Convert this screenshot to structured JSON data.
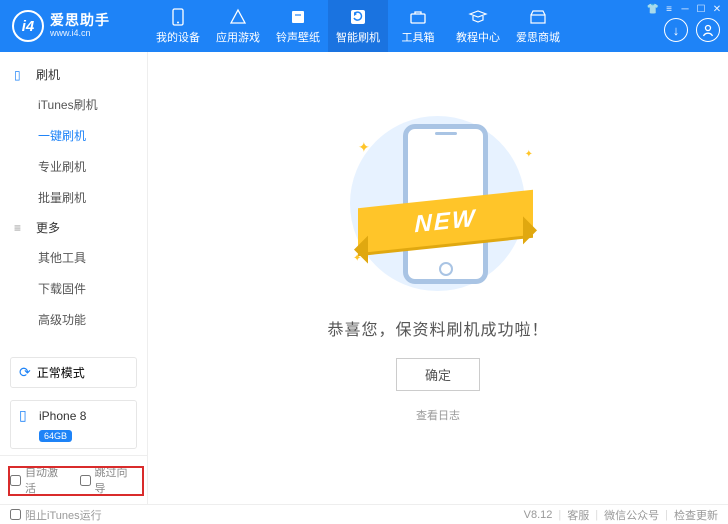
{
  "logo": {
    "badge": "i4",
    "name": "爱思助手",
    "url": "www.i4.cn"
  },
  "nav": [
    {
      "label": "我的设备"
    },
    {
      "label": "应用游戏"
    },
    {
      "label": "铃声壁纸"
    },
    {
      "label": "智能刷机"
    },
    {
      "label": "工具箱"
    },
    {
      "label": "教程中心"
    },
    {
      "label": "爱思商城"
    }
  ],
  "sidebar": {
    "group1": {
      "title": "刷机"
    },
    "items1": [
      {
        "label": "iTunes刷机"
      },
      {
        "label": "一键刷机"
      },
      {
        "label": "专业刷机"
      },
      {
        "label": "批量刷机"
      }
    ],
    "group2": {
      "title": "更多"
    },
    "items2": [
      {
        "label": "其他工具"
      },
      {
        "label": "下载固件"
      },
      {
        "label": "高级功能"
      }
    ]
  },
  "mode": {
    "label": "正常模式"
  },
  "device": {
    "name": "iPhone 8",
    "storage": "64GB"
  },
  "options": {
    "auto_activate": "自动激活",
    "skip_guide": "跳过向导"
  },
  "main": {
    "ribbon": "NEW",
    "message": "恭喜您，保资料刷机成功啦！",
    "ok": "确定",
    "log": "查看日志"
  },
  "status": {
    "block_itunes": "阻止iTunes运行",
    "version": "V8.12",
    "support": "客服",
    "wechat": "微信公众号",
    "update": "检查更新"
  }
}
